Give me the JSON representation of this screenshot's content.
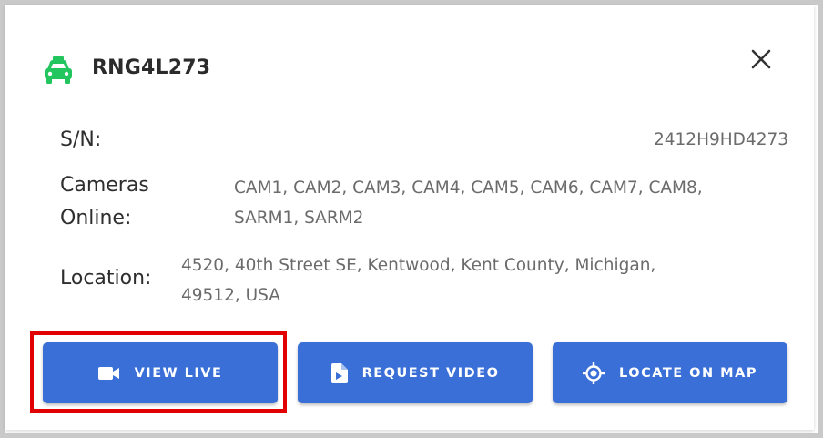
{
  "device": {
    "name": "RNG4L273",
    "icon": "car-icon",
    "icon_color": "#22c55e"
  },
  "fields": {
    "sn_label": "S/N:",
    "sn_value": "2412H9HD4273",
    "cameras_label_line1": "Cameras",
    "cameras_label_line2": "Online:",
    "cameras_value_line1": "CAM1, CAM2, CAM3, CAM4, CAM5, CAM6, CAM7, CAM8,",
    "cameras_value_line2": "SARM1, SARM2",
    "location_label": "Location:",
    "location_value_line1": "4520, 40th Street SE, Kentwood, Kent County, Michigan,",
    "location_value_line2": "49512, USA"
  },
  "actions": {
    "view_live": "VIEW LIVE",
    "request_video": "REQUEST VIDEO",
    "locate_on_map": "LOCATE ON MAP"
  },
  "colors": {
    "button": "#3a6fd8",
    "highlight": "#e00000"
  }
}
